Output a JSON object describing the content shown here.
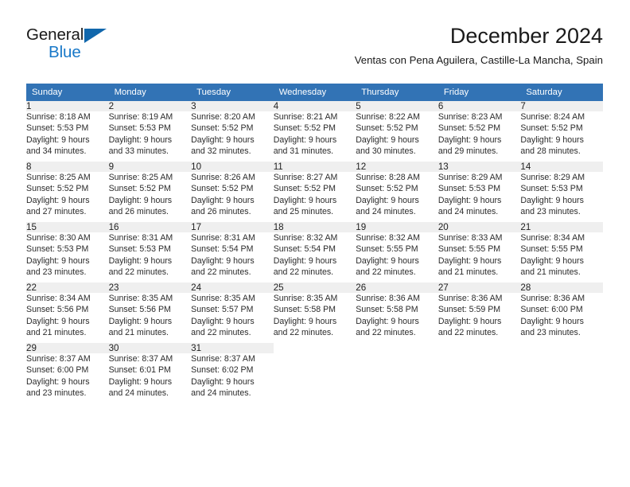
{
  "brand": {
    "name_part1": "General",
    "name_part2": "Blue",
    "logo_icon": "triangle-logo"
  },
  "header": {
    "month_title": "December 2024",
    "location": "Ventas con Pena Aguilera, Castille-La Mancha, Spain"
  },
  "colors": {
    "header_blue": "#3273b5",
    "brand_blue": "#1878c8",
    "logo_blue": "#1167ac",
    "daynum_background": "#efefef",
    "separator": "#9a9a9a"
  },
  "weekday_headers": [
    "Sunday",
    "Monday",
    "Tuesday",
    "Wednesday",
    "Thursday",
    "Friday",
    "Saturday"
  ],
  "weeks": [
    [
      {
        "day": "1",
        "sunrise": "Sunrise: 8:18 AM",
        "sunset": "Sunset: 5:53 PM",
        "daylight_line1": "Daylight: 9 hours",
        "daylight_line2": "and 34 minutes."
      },
      {
        "day": "2",
        "sunrise": "Sunrise: 8:19 AM",
        "sunset": "Sunset: 5:53 PM",
        "daylight_line1": "Daylight: 9 hours",
        "daylight_line2": "and 33 minutes."
      },
      {
        "day": "3",
        "sunrise": "Sunrise: 8:20 AM",
        "sunset": "Sunset: 5:52 PM",
        "daylight_line1": "Daylight: 9 hours",
        "daylight_line2": "and 32 minutes."
      },
      {
        "day": "4",
        "sunrise": "Sunrise: 8:21 AM",
        "sunset": "Sunset: 5:52 PM",
        "daylight_line1": "Daylight: 9 hours",
        "daylight_line2": "and 31 minutes."
      },
      {
        "day": "5",
        "sunrise": "Sunrise: 8:22 AM",
        "sunset": "Sunset: 5:52 PM",
        "daylight_line1": "Daylight: 9 hours",
        "daylight_line2": "and 30 minutes."
      },
      {
        "day": "6",
        "sunrise": "Sunrise: 8:23 AM",
        "sunset": "Sunset: 5:52 PM",
        "daylight_line1": "Daylight: 9 hours",
        "daylight_line2": "and 29 minutes."
      },
      {
        "day": "7",
        "sunrise": "Sunrise: 8:24 AM",
        "sunset": "Sunset: 5:52 PM",
        "daylight_line1": "Daylight: 9 hours",
        "daylight_line2": "and 28 minutes."
      }
    ],
    [
      {
        "day": "8",
        "sunrise": "Sunrise: 8:25 AM",
        "sunset": "Sunset: 5:52 PM",
        "daylight_line1": "Daylight: 9 hours",
        "daylight_line2": "and 27 minutes."
      },
      {
        "day": "9",
        "sunrise": "Sunrise: 8:25 AM",
        "sunset": "Sunset: 5:52 PM",
        "daylight_line1": "Daylight: 9 hours",
        "daylight_line2": "and 26 minutes."
      },
      {
        "day": "10",
        "sunrise": "Sunrise: 8:26 AM",
        "sunset": "Sunset: 5:52 PM",
        "daylight_line1": "Daylight: 9 hours",
        "daylight_line2": "and 26 minutes."
      },
      {
        "day": "11",
        "sunrise": "Sunrise: 8:27 AM",
        "sunset": "Sunset: 5:52 PM",
        "daylight_line1": "Daylight: 9 hours",
        "daylight_line2": "and 25 minutes."
      },
      {
        "day": "12",
        "sunrise": "Sunrise: 8:28 AM",
        "sunset": "Sunset: 5:52 PM",
        "daylight_line1": "Daylight: 9 hours",
        "daylight_line2": "and 24 minutes."
      },
      {
        "day": "13",
        "sunrise": "Sunrise: 8:29 AM",
        "sunset": "Sunset: 5:53 PM",
        "daylight_line1": "Daylight: 9 hours",
        "daylight_line2": "and 24 minutes."
      },
      {
        "day": "14",
        "sunrise": "Sunrise: 8:29 AM",
        "sunset": "Sunset: 5:53 PM",
        "daylight_line1": "Daylight: 9 hours",
        "daylight_line2": "and 23 minutes."
      }
    ],
    [
      {
        "day": "15",
        "sunrise": "Sunrise: 8:30 AM",
        "sunset": "Sunset: 5:53 PM",
        "daylight_line1": "Daylight: 9 hours",
        "daylight_line2": "and 23 minutes."
      },
      {
        "day": "16",
        "sunrise": "Sunrise: 8:31 AM",
        "sunset": "Sunset: 5:53 PM",
        "daylight_line1": "Daylight: 9 hours",
        "daylight_line2": "and 22 minutes."
      },
      {
        "day": "17",
        "sunrise": "Sunrise: 8:31 AM",
        "sunset": "Sunset: 5:54 PM",
        "daylight_line1": "Daylight: 9 hours",
        "daylight_line2": "and 22 minutes."
      },
      {
        "day": "18",
        "sunrise": "Sunrise: 8:32 AM",
        "sunset": "Sunset: 5:54 PM",
        "daylight_line1": "Daylight: 9 hours",
        "daylight_line2": "and 22 minutes."
      },
      {
        "day": "19",
        "sunrise": "Sunrise: 8:32 AM",
        "sunset": "Sunset: 5:55 PM",
        "daylight_line1": "Daylight: 9 hours",
        "daylight_line2": "and 22 minutes."
      },
      {
        "day": "20",
        "sunrise": "Sunrise: 8:33 AM",
        "sunset": "Sunset: 5:55 PM",
        "daylight_line1": "Daylight: 9 hours",
        "daylight_line2": "and 21 minutes."
      },
      {
        "day": "21",
        "sunrise": "Sunrise: 8:34 AM",
        "sunset": "Sunset: 5:55 PM",
        "daylight_line1": "Daylight: 9 hours",
        "daylight_line2": "and 21 minutes."
      }
    ],
    [
      {
        "day": "22",
        "sunrise": "Sunrise: 8:34 AM",
        "sunset": "Sunset: 5:56 PM",
        "daylight_line1": "Daylight: 9 hours",
        "daylight_line2": "and 21 minutes."
      },
      {
        "day": "23",
        "sunrise": "Sunrise: 8:35 AM",
        "sunset": "Sunset: 5:56 PM",
        "daylight_line1": "Daylight: 9 hours",
        "daylight_line2": "and 21 minutes."
      },
      {
        "day": "24",
        "sunrise": "Sunrise: 8:35 AM",
        "sunset": "Sunset: 5:57 PM",
        "daylight_line1": "Daylight: 9 hours",
        "daylight_line2": "and 22 minutes."
      },
      {
        "day": "25",
        "sunrise": "Sunrise: 8:35 AM",
        "sunset": "Sunset: 5:58 PM",
        "daylight_line1": "Daylight: 9 hours",
        "daylight_line2": "and 22 minutes."
      },
      {
        "day": "26",
        "sunrise": "Sunrise: 8:36 AM",
        "sunset": "Sunset: 5:58 PM",
        "daylight_line1": "Daylight: 9 hours",
        "daylight_line2": "and 22 minutes."
      },
      {
        "day": "27",
        "sunrise": "Sunrise: 8:36 AM",
        "sunset": "Sunset: 5:59 PM",
        "daylight_line1": "Daylight: 9 hours",
        "daylight_line2": "and 22 minutes."
      },
      {
        "day": "28",
        "sunrise": "Sunrise: 8:36 AM",
        "sunset": "Sunset: 6:00 PM",
        "daylight_line1": "Daylight: 9 hours",
        "daylight_line2": "and 23 minutes."
      }
    ],
    [
      {
        "day": "29",
        "sunrise": "Sunrise: 8:37 AM",
        "sunset": "Sunset: 6:00 PM",
        "daylight_line1": "Daylight: 9 hours",
        "daylight_line2": "and 23 minutes."
      },
      {
        "day": "30",
        "sunrise": "Sunrise: 8:37 AM",
        "sunset": "Sunset: 6:01 PM",
        "daylight_line1": "Daylight: 9 hours",
        "daylight_line2": "and 24 minutes."
      },
      {
        "day": "31",
        "sunrise": "Sunrise: 8:37 AM",
        "sunset": "Sunset: 6:02 PM",
        "daylight_line1": "Daylight: 9 hours",
        "daylight_line2": "and 24 minutes."
      },
      {
        "day": "",
        "sunrise": "",
        "sunset": "",
        "daylight_line1": "",
        "daylight_line2": ""
      },
      {
        "day": "",
        "sunrise": "",
        "sunset": "",
        "daylight_line1": "",
        "daylight_line2": ""
      },
      {
        "day": "",
        "sunrise": "",
        "sunset": "",
        "daylight_line1": "",
        "daylight_line2": ""
      },
      {
        "day": "",
        "sunrise": "",
        "sunset": "",
        "daylight_line1": "",
        "daylight_line2": ""
      }
    ]
  ]
}
